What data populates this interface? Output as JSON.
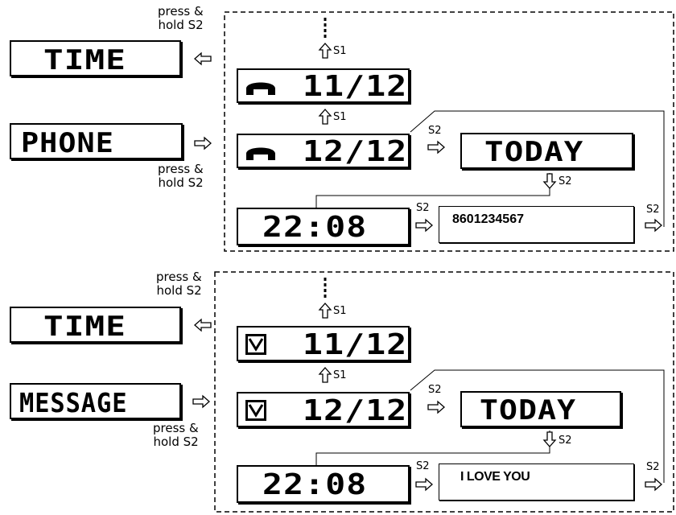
{
  "panels": [
    {
      "id": "phone",
      "press_hold_top": "press &\nhold S2",
      "press_hold_bottom": "press &\nhold S2",
      "mode_time_label": "TIME",
      "mode_label": "PHONE",
      "entry_icon": "handset-icon",
      "entry_prev": "11/12",
      "entry_current": "12/12",
      "today_label": "TODAY",
      "clock_time": "22:08",
      "detail_text": "8601234567",
      "s1_upper": "S1",
      "s1_lower": "S1",
      "s2_today": "S2",
      "s2_down": "S2",
      "s2_detail": "S2",
      "s2_right": "S2"
    },
    {
      "id": "message",
      "press_hold_top": "press &\nhold S2",
      "press_hold_bottom": "press &\nhold S2",
      "mode_time_label": "TIME",
      "mode_label": "MESSAGE",
      "entry_icon": "envelope-icon",
      "entry_prev": "11/12",
      "entry_current": "12/12",
      "today_label": "TODAY",
      "clock_time": "22:08",
      "detail_text": "I LOVE YOU",
      "s1_upper": "S1",
      "s1_lower": "S1",
      "s2_today": "S2",
      "s2_down": "S2",
      "s2_detail": "S2",
      "s2_right": "S2"
    }
  ]
}
